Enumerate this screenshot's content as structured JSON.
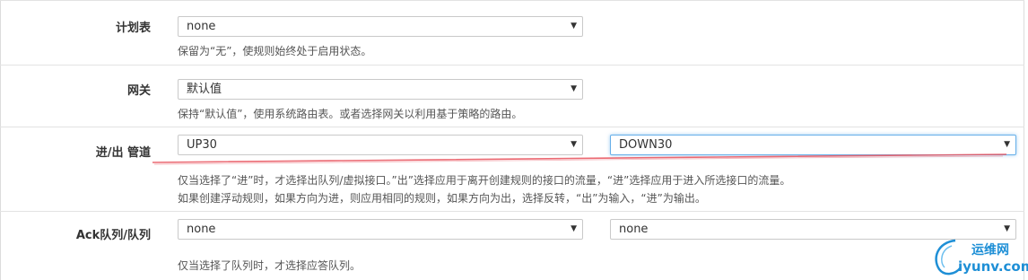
{
  "rows": [
    {
      "label": "计划表",
      "select_value": "none",
      "help": [
        "保留为“无”，使规则始终处于启用状态。"
      ]
    },
    {
      "label": "网关",
      "select_value": "默认值",
      "help": [
        "保持“默认值”，使用系统路由表。或者选择网关以利用基于策略的路由。"
      ]
    },
    {
      "label": "进/出 管道",
      "select_value": "UP30",
      "select_value_2": "DOWN30",
      "help": [
        "仅当选择了“进”时，才选择出队列/虚拟接口。”出”选择应用于离开创建规则的接口的流量，“进”选择应用于进入所选接口的流量。",
        "如果创建浮动规则，如果方向为进，则应用相同的规则，如果方向为出，选择反转，“出”为输入，“进”为输出。"
      ]
    },
    {
      "label": "Ack队列/队列",
      "select_value": "none",
      "select_value_2": "none",
      "help": [
        "仅当选择了队列时，才选择应答队列。"
      ]
    }
  ],
  "watermark": {
    "name": "运维网",
    "url": "iyunv.com"
  },
  "colors": {
    "annotation_red": "#e8505b",
    "focus_border": "#66afe9",
    "watermark_blue": "#1e8fd6"
  }
}
